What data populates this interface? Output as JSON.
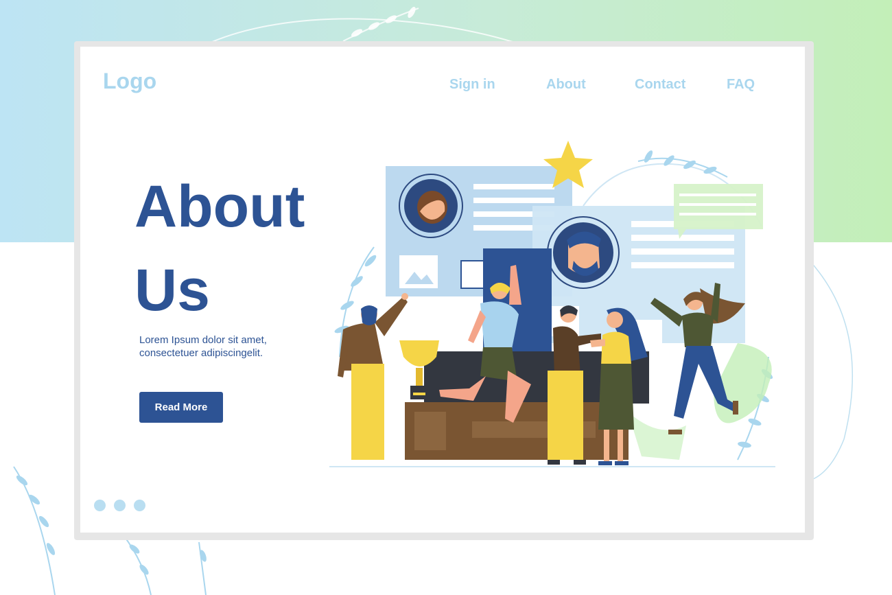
{
  "header": {
    "logo": "Logo",
    "nav": [
      {
        "label": "Sign in"
      },
      {
        "label": "About"
      },
      {
        "label": "Contact"
      },
      {
        "label": "FAQ"
      }
    ]
  },
  "hero": {
    "title_line1": "About",
    "title_line2": "Us",
    "description_line1": "Lorem Ipsum dolor sit amet,",
    "description_line2": "consectetuer adipiscingelit.",
    "cta_label": "Read More"
  },
  "pagination": {
    "count": 3,
    "active": 0
  },
  "colors": {
    "primary": "#2d5394",
    "nav_text": "#a9d6ee",
    "panel_blue": "#bcd9ef",
    "accent_yellow": "#f5d547",
    "accent_green": "#c3efb8"
  }
}
